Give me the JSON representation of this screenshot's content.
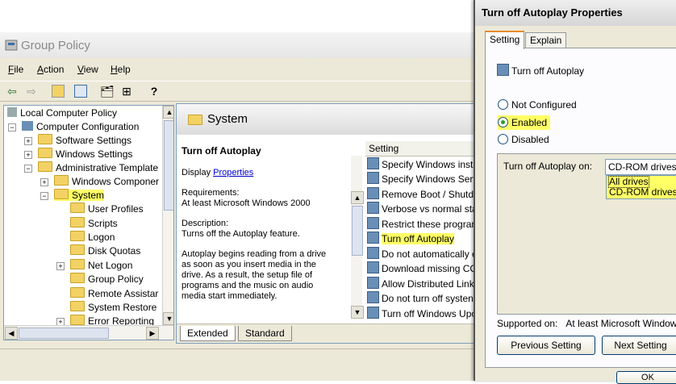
{
  "window": {
    "title": "Group Policy"
  },
  "menu": [
    {
      "label": "File",
      "u": "F",
      "rest": "ile"
    },
    {
      "label": "Action",
      "u": "A",
      "rest": "ction"
    },
    {
      "label": "View",
      "u": "V",
      "rest": "iew"
    },
    {
      "label": "Help",
      "u": "H",
      "rest": "elp"
    }
  ],
  "tree": [
    {
      "label": "Local Computer Policy"
    },
    {
      "label": "Computer Configuration"
    },
    {
      "label": "Software Settings"
    },
    {
      "label": "Windows Settings"
    },
    {
      "label": "Administrative Template"
    },
    {
      "label": "Windows Componer"
    },
    {
      "label": "System"
    },
    {
      "label": "User Profiles"
    },
    {
      "label": "Scripts"
    },
    {
      "label": "Logon"
    },
    {
      "label": "Disk Quotas"
    },
    {
      "label": "Net Logon"
    },
    {
      "label": "Group Policy"
    },
    {
      "label": "Remote Assistar"
    },
    {
      "label": "System Restore"
    },
    {
      "label": "Error Reporting"
    }
  ],
  "pane": {
    "header": "System",
    "policy_title": "Turn off Autoplay",
    "display_label": "Display",
    "properties_link": "Properties",
    "requirements_label": "Requirements:",
    "requirements_value": "At least Microsoft Windows 2000",
    "description_label": "Description:",
    "description_value": "Turns off the Autoplay feature.",
    "body": [
      "Autoplay begins reading from a drive",
      "as soon as you insert media in the",
      "drive. As a result, the setup file of",
      "programs and the music on audio",
      "media start immediately."
    ],
    "list_header": "Setting",
    "list": [
      "Specify Windows insta",
      "Specify Windows Serv",
      "Remove Boot / Shutdo",
      "Verbose vs normal sta",
      "Restrict these prograr",
      "Turn off Autoplay",
      "Do not automatically e",
      "Download missing COI",
      "Allow Distributed Link",
      "Do not turn off systen",
      "Turn off Windows Upc"
    ],
    "tabs": [
      "Extended",
      "Standard"
    ]
  },
  "dialog": {
    "title": "Turn off Autoplay Properties",
    "tabs": [
      "Setting",
      "Explain"
    ],
    "policy_name": "Turn off Autoplay",
    "radios": [
      {
        "label": "Not Configured",
        "selected": false
      },
      {
        "label": "Enabled",
        "selected": true
      },
      {
        "label": "Disabled",
        "selected": false
      }
    ],
    "option_label": "Turn off Autoplay on:",
    "combo_value": "CD-ROM drives",
    "combo_options": [
      "All drives",
      "CD-ROM drives"
    ],
    "supported_label": "Supported on:",
    "supported_value": "At least Microsoft Windows",
    "buttons": {
      "previous": "Previous Setting",
      "next": "Next Setting",
      "ok": "OK"
    }
  }
}
